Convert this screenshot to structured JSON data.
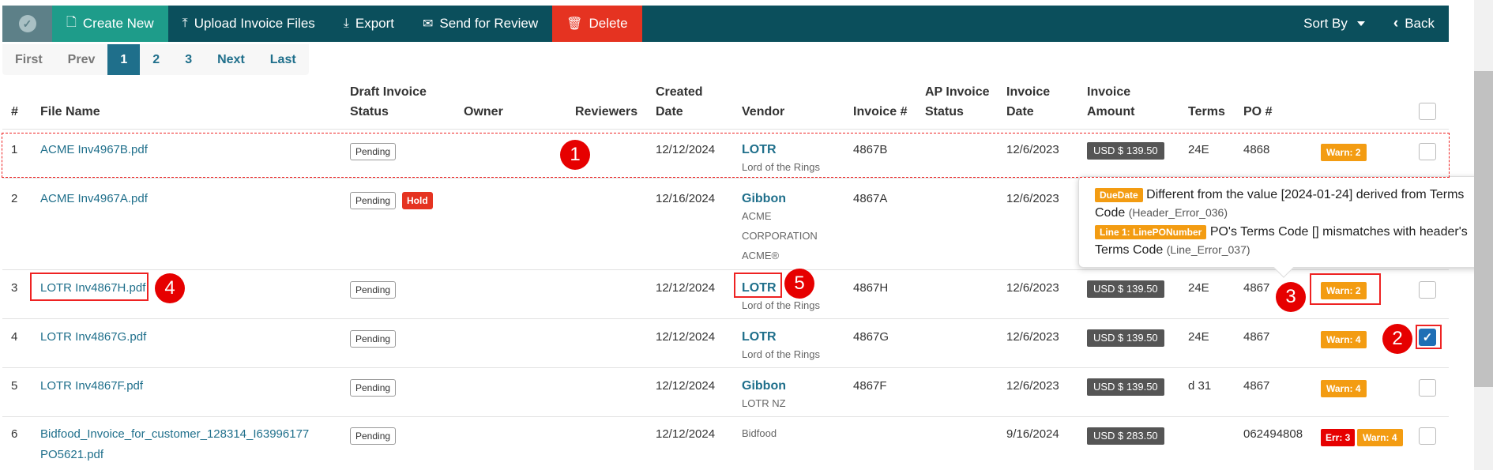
{
  "toolbar": {
    "create_new": "Create New",
    "upload": "Upload Invoice Files",
    "export": "Export",
    "send_review": "Send for Review",
    "delete": "Delete",
    "sort_by": "Sort By",
    "back": "Back"
  },
  "pager": {
    "first": "First",
    "prev": "Prev",
    "p1": "1",
    "p2": "2",
    "p3": "3",
    "next": "Next",
    "last": "Last"
  },
  "headers": {
    "num": "#",
    "file_name": "File Name",
    "draft_status_1": "Draft Invoice",
    "draft_status_2": "Status",
    "owner": "Owner",
    "reviewers": "Reviewers",
    "created_1": "Created",
    "created_2": "Date",
    "vendor": "Vendor",
    "invoice_no": "Invoice #",
    "ap_status_1": "AP Invoice",
    "ap_status_2": "Status",
    "invoice_date_1": "Invoice",
    "invoice_date_2": "Date",
    "amount_1": "Invoice",
    "amount_2": "Amount",
    "terms": "Terms",
    "po": "PO #"
  },
  "rows": [
    {
      "n": "1",
      "file": "ACME Inv4967B.pdf",
      "status": "Pending",
      "created": "12/12/2024",
      "vendor": "LOTR",
      "vendor_sub": "Lord of the Rings",
      "inv": "4867B",
      "inv_date": "12/6/2023",
      "amount": "USD $ 139.50",
      "terms": "24E",
      "po": "4868",
      "warn": "Warn: 2",
      "checked": false
    },
    {
      "n": "2",
      "file": "ACME Inv4967A.pdf",
      "status": "Pending",
      "hold": "Hold",
      "created": "12/16/2024",
      "vendor": "Gibbon",
      "vendor_sub1": "ACME",
      "vendor_sub2": "CORPORATION",
      "vendor_sub3": "ACME®",
      "inv": "4867A",
      "inv_date": "12/6/2023",
      "checked": false
    },
    {
      "n": "3",
      "file": "LOTR Inv4867H.pdf",
      "status": "Pending",
      "created": "12/12/2024",
      "vendor": "LOTR",
      "vendor_sub": "Lord of the Rings",
      "inv": "4867H",
      "inv_date": "12/6/2023",
      "amount": "USD $ 139.50",
      "terms": "24E",
      "po": "4867",
      "warn": "Warn: 2",
      "checked": false
    },
    {
      "n": "4",
      "file": "LOTR Inv4867G.pdf",
      "status": "Pending",
      "created": "12/12/2024",
      "vendor": "LOTR",
      "vendor_sub": "Lord of the Rings",
      "inv": "4867G",
      "inv_date": "12/6/2023",
      "amount": "USD $ 139.50",
      "terms": "24E",
      "po": "4867",
      "warn": "Warn: 4",
      "checked": true
    },
    {
      "n": "5",
      "file": "LOTR Inv4867F.pdf",
      "status": "Pending",
      "created": "12/12/2024",
      "vendor": "Gibbon",
      "vendor_sub": "LOTR NZ",
      "inv": "4867F",
      "inv_date": "12/6/2023",
      "amount": "USD $ 139.50",
      "terms": "d 31",
      "po": "4867",
      "warn": "Warn: 4",
      "checked": false
    },
    {
      "n": "6",
      "file1": "Bidfood_Invoice_for_customer_128314_I63996177",
      "file2": "PO5621.pdf",
      "status": "Pending",
      "created": "12/12/2024",
      "vendor_plain": "Bidfood",
      "inv_date": "9/16/2024",
      "amount": "USD $ 283.50",
      "po": "062494808",
      "err": "Err: 3",
      "warn": "Warn: 4",
      "checked": false
    }
  ],
  "tooltip": {
    "tag1": "DueDate",
    "msg1": "Different from the value [2024-01-24] derived from Terms Code",
    "code1": "(Header_Error_036)",
    "tag2": "Line 1: LinePONumber",
    "msg2": "PO's Terms Code [] mismatches with header's Terms Code",
    "code2": "(Line_Error_037)"
  },
  "annotations": {
    "a1": "1",
    "a2": "2",
    "a3": "3",
    "a4": "4",
    "a5": "5"
  },
  "colors": {
    "toolbar": "#0b4f5c",
    "create": "#1e9c8a",
    "delete": "#e53321",
    "link": "#1f6f8b",
    "warn": "#f39c12",
    "err": "#e60000"
  }
}
